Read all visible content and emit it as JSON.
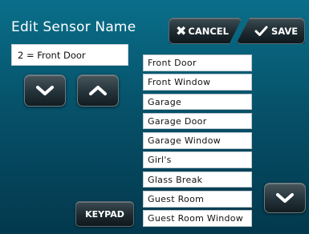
{
  "title": "Edit Sensor Name",
  "buttons": {
    "cancel": "CANCEL",
    "save": "SAVE",
    "keypad": "KEYPAD"
  },
  "sensor_name_value": "2 = Front Door",
  "name_options": [
    "Front Door",
    "Front Window",
    "Garage",
    "Garage Door",
    "Garage Window",
    "Girl's",
    "Glass Break",
    "Guest Room",
    "Guest Room Window"
  ],
  "icons": {
    "cancel": "close-icon",
    "save": "checkmark-icon",
    "scroll_down": "chevron-down-icon",
    "scroll_up": "chevron-up-icon"
  },
  "colors": {
    "background_top": "#0a6f8a",
    "background_bottom": "#03384d",
    "button": "#1d2a30",
    "text": "#ffffff"
  }
}
